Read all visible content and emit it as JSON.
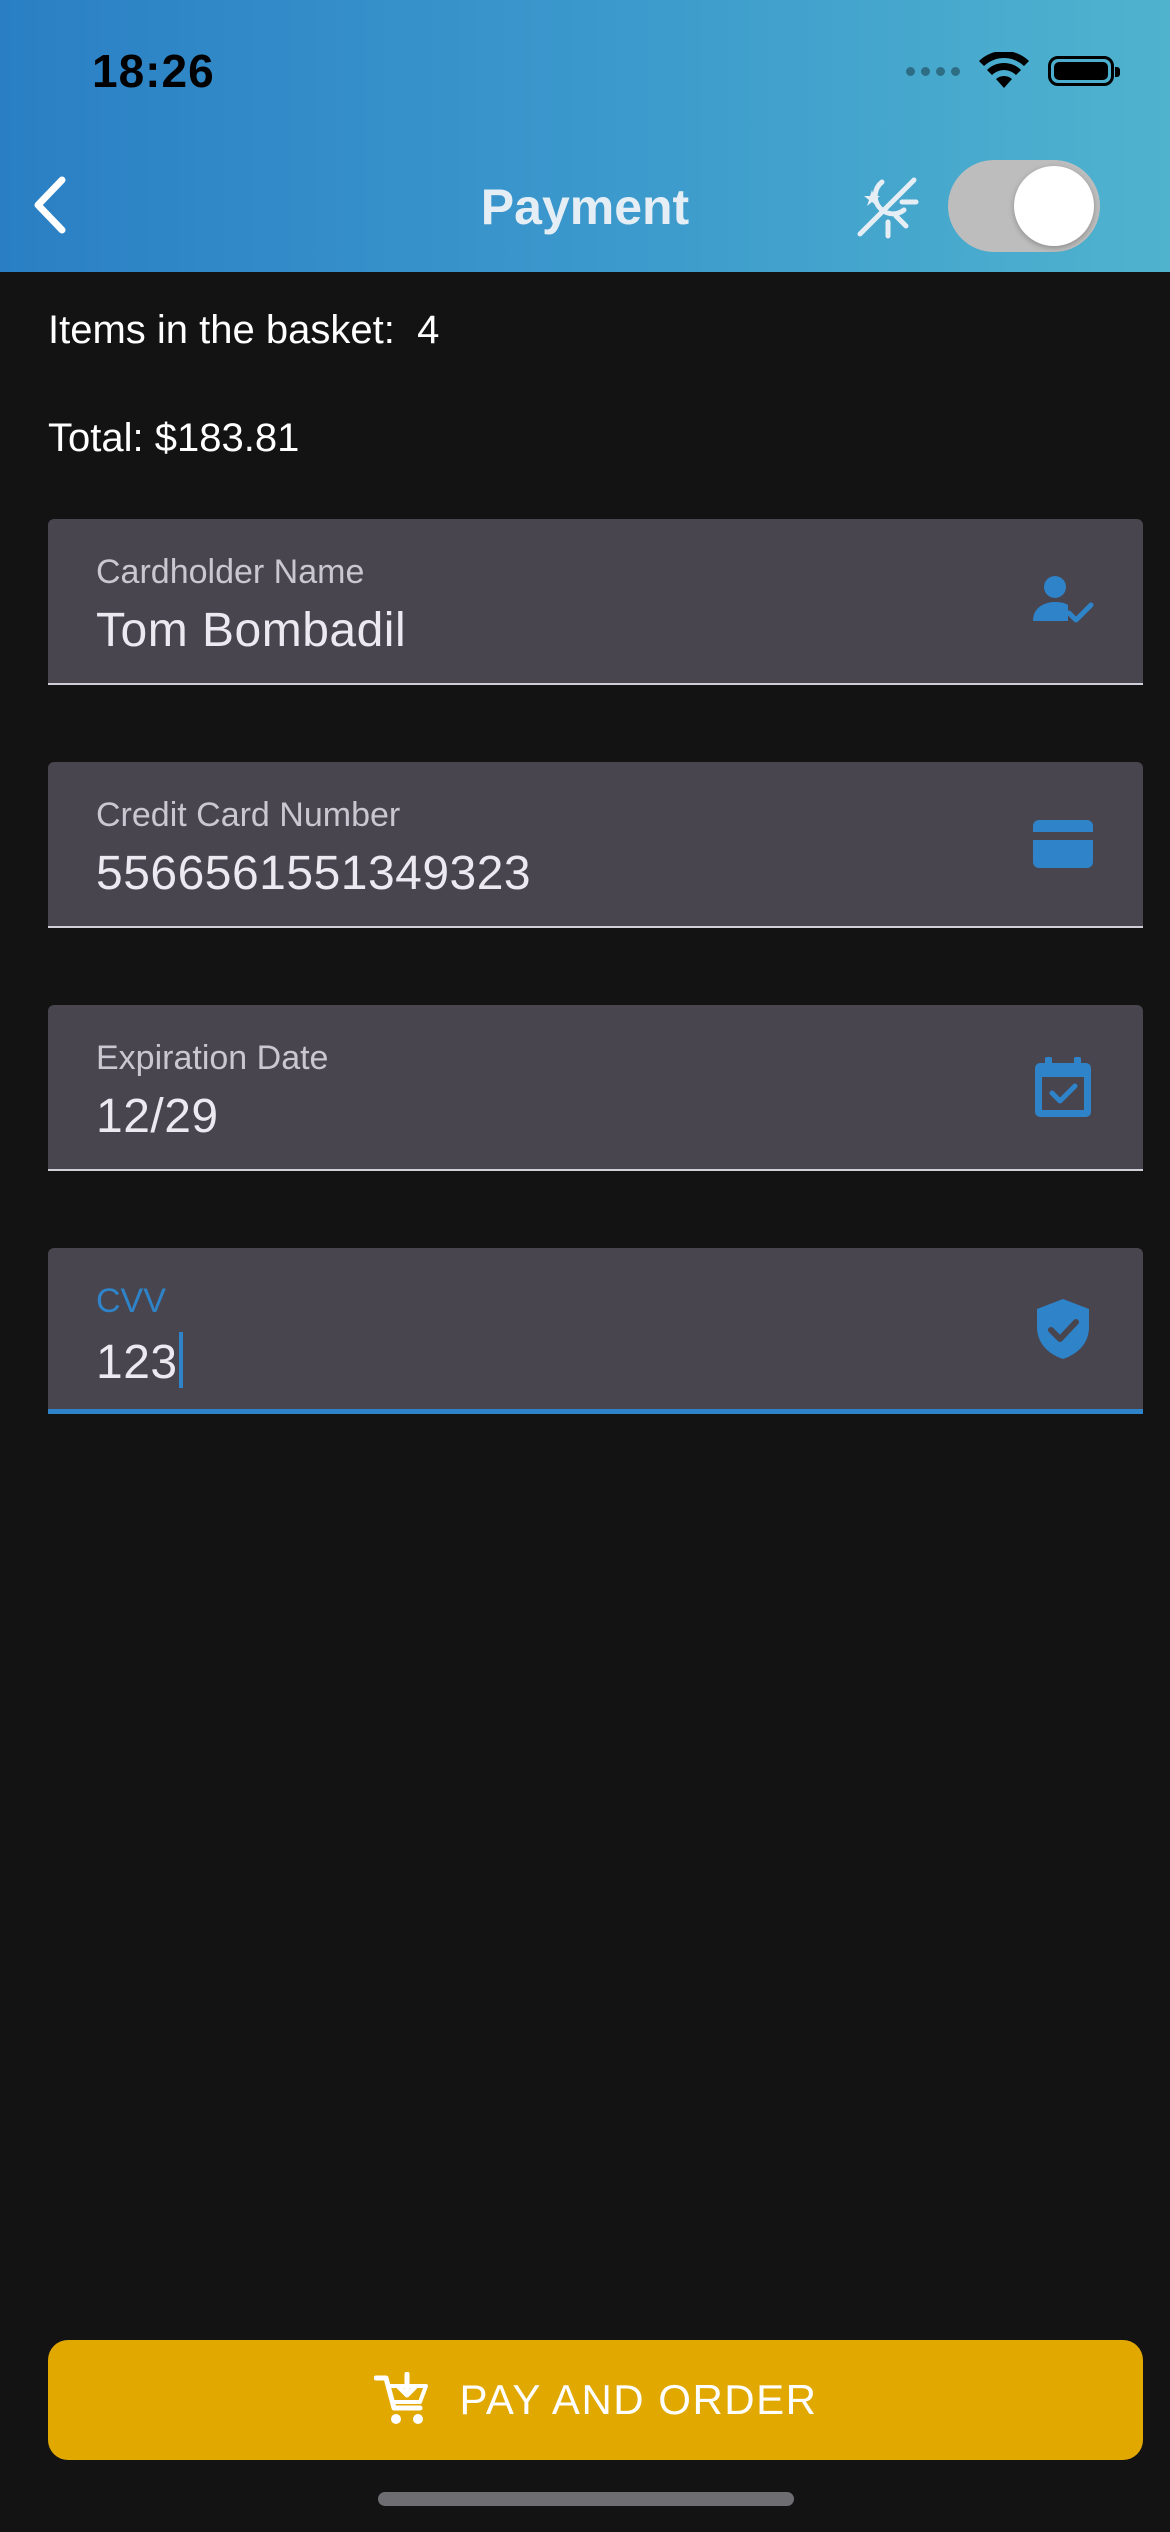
{
  "status_bar": {
    "time": "18:26"
  },
  "nav": {
    "title": "Payment",
    "back_icon": "chevron-left-icon",
    "theme_icon": "theme-mode-icon",
    "dark_mode_toggle_on": true
  },
  "summary": {
    "items_label": "Items in the basket:",
    "items_count": "4",
    "total_text": "Total: $183.81"
  },
  "form": {
    "cardholder": {
      "label": "Cardholder Name",
      "value": "Tom Bombadil",
      "icon": "person-check-icon"
    },
    "card_number": {
      "label": "Credit Card Number",
      "value": "5566561551349323",
      "icon": "credit-card-icon"
    },
    "expiration": {
      "label": "Expiration Date",
      "value": "12/29",
      "icon": "calendar-check-icon"
    },
    "cvv": {
      "label": "CVV",
      "value": "123",
      "icon": "shield-check-icon"
    }
  },
  "actions": {
    "pay_label": "PAY AND ORDER",
    "pay_icon": "cart-icon"
  },
  "colors": {
    "header_gradient_start": "#2a7fc4",
    "header_gradient_end": "#4fb3ce",
    "background": "#131314",
    "field_background": "#48454f",
    "accent": "#2e83c9",
    "pay_button": "#e1a800"
  }
}
